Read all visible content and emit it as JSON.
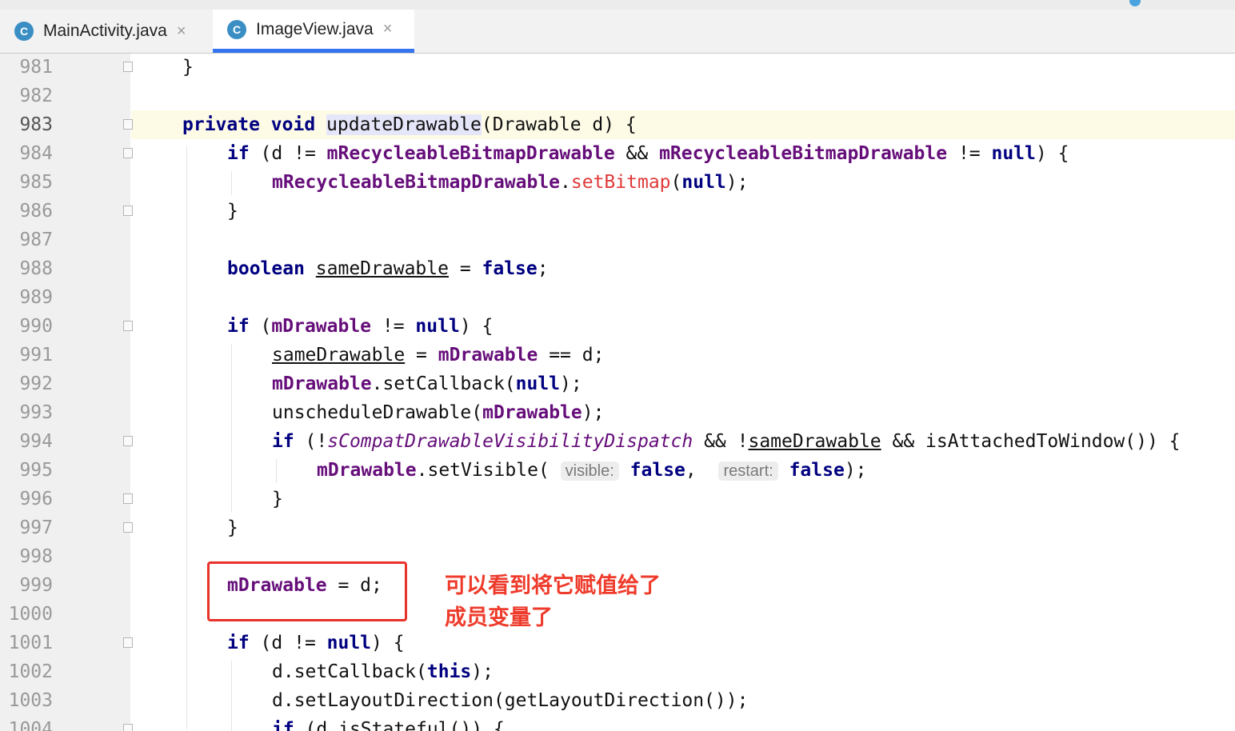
{
  "tabs": [
    {
      "label": "MainActivity.java",
      "icon": "class-icon",
      "icon_letter": "C",
      "active": false
    },
    {
      "label": "ImageView.java",
      "icon": "class-icon",
      "icon_letter": "C",
      "active": true
    }
  ],
  "close_glyph": "×",
  "colors": {
    "keyword": "#000080",
    "field": "#660e7a",
    "highlight_line": "#fdfbe6",
    "annotation": "#ee3b2b",
    "active_tab": "#3574f0"
  },
  "lines": [
    {
      "n": "981",
      "segs": [
        "}"
      ]
    },
    {
      "n": "982",
      "segs": []
    },
    {
      "n": "983",
      "segs": [
        "private",
        " ",
        "void",
        " ",
        "updateDrawable",
        "(Drawable d) {"
      ]
    },
    {
      "n": "984",
      "segs": [
        "if",
        " (d != ",
        "mRecycleableBitmapDrawable",
        " && ",
        "mRecycleableBitmapDrawable",
        " != ",
        "null",
        ") {"
      ]
    },
    {
      "n": "985",
      "segs": [
        "mRecycleableBitmapDrawable",
        ".",
        "setBitmap",
        "(",
        "null",
        ");"
      ]
    },
    {
      "n": "986",
      "segs": [
        "}"
      ]
    },
    {
      "n": "987",
      "segs": []
    },
    {
      "n": "988",
      "segs": [
        "boolean",
        " ",
        "sameDrawable",
        " = ",
        "false",
        ";"
      ]
    },
    {
      "n": "989",
      "segs": []
    },
    {
      "n": "990",
      "segs": [
        "if",
        " (",
        "mDrawable",
        " != ",
        "null",
        ") {"
      ]
    },
    {
      "n": "991",
      "segs": [
        "sameDrawable",
        " = ",
        "mDrawable",
        " == d;"
      ]
    },
    {
      "n": "992",
      "segs": [
        "mDrawable",
        ".setCallback(",
        "null",
        ");"
      ]
    },
    {
      "n": "993",
      "segs": [
        "unscheduleDrawable(",
        "mDrawable",
        ");"
      ]
    },
    {
      "n": "994",
      "segs": [
        "if",
        " (!",
        "sCompatDrawableVisibilityDispatch",
        " && !",
        "sameDrawable",
        " && isAttachedToWindow()) {"
      ]
    },
    {
      "n": "995",
      "segs": [
        "mDrawable",
        ".setVisible(",
        "visible:",
        "false",
        ",",
        "restart:",
        "false",
        ");"
      ]
    },
    {
      "n": "996",
      "segs": [
        "}"
      ]
    },
    {
      "n": "997",
      "segs": [
        "}"
      ]
    },
    {
      "n": "998",
      "segs": []
    },
    {
      "n": "999",
      "segs": [
        "mDrawable",
        " = d;"
      ]
    },
    {
      "n": "1000",
      "segs": []
    },
    {
      "n": "1001",
      "segs": [
        "if",
        " (d != ",
        "null",
        ") {"
      ]
    },
    {
      "n": "1002",
      "segs": [
        "d.setCallback(",
        "this",
        ");"
      ]
    },
    {
      "n": "1003",
      "segs": [
        "d.setLayoutDirection(getLayoutDirection());"
      ]
    },
    {
      "n": "1004",
      "segs": [
        "if",
        " (d.isStateful()) {"
      ]
    }
  ],
  "annotation": {
    "line1": "可以看到将它赋值给了",
    "line2": "成员变量了"
  }
}
